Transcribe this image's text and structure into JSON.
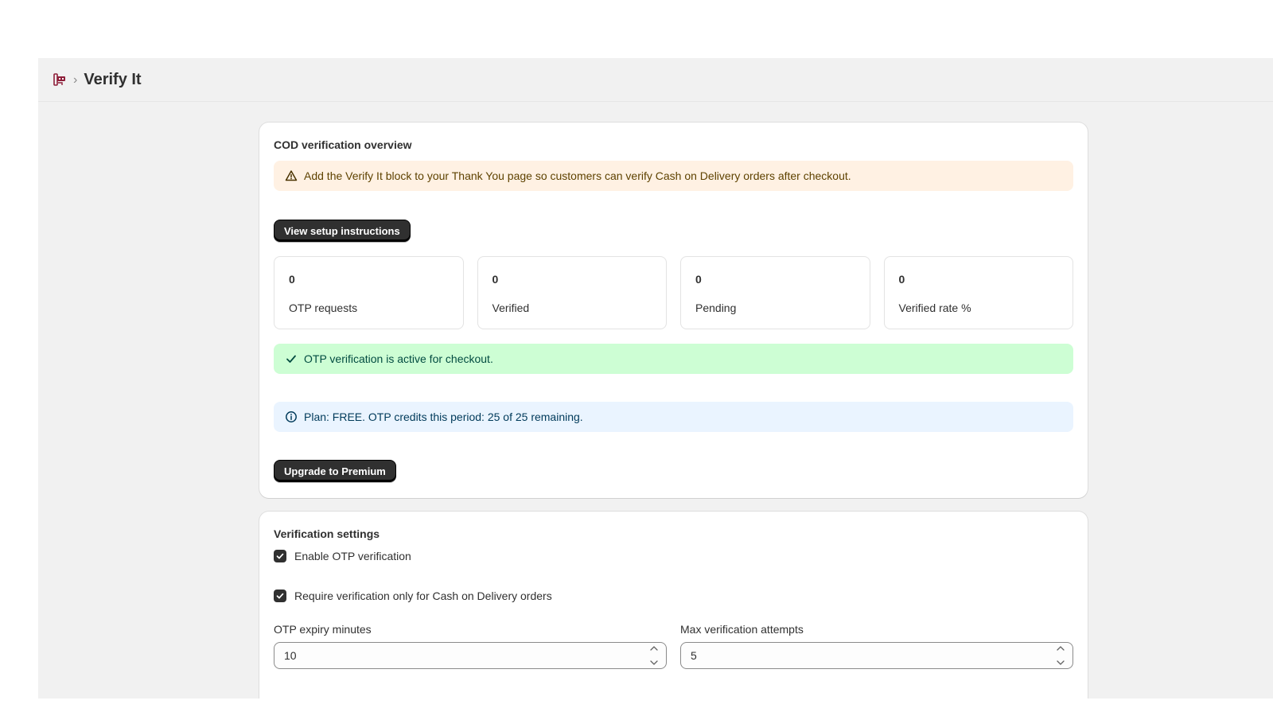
{
  "app": {
    "title": "Verify It",
    "breadcrumb_separator": "›",
    "icon": "app-logo-icon",
    "accent_color": "#8e1f3a"
  },
  "overview": {
    "title": "COD verification overview",
    "warning_banner": {
      "icon": "warning-triangle-icon",
      "text": "Add the Verify It block to your Thank You page so customers can verify Cash on Delivery orders after checkout."
    },
    "setup_button_label": "View setup instructions",
    "stats": [
      {
        "value": "0",
        "label": "OTP requests"
      },
      {
        "value": "0",
        "label": "Verified"
      },
      {
        "value": "0",
        "label": "Pending"
      },
      {
        "value": "0",
        "label": "Verified rate %"
      }
    ],
    "success_banner": {
      "icon": "checkmark-icon",
      "text": "OTP verification is active for checkout."
    },
    "info_banner": {
      "icon": "info-icon",
      "text": "Plan: FREE. OTP credits this period: 25 of 25 remaining."
    },
    "upgrade_button_label": "Upgrade to Premium"
  },
  "settings": {
    "title": "Verification settings",
    "checkboxes": [
      {
        "label": "Enable OTP verification",
        "checked": true
      },
      {
        "label": "Require verification only for Cash on Delivery orders",
        "checked": true
      }
    ],
    "otp_expiry": {
      "label": "OTP expiry minutes",
      "value": "10"
    },
    "max_attempts": {
      "label": "Max verification attempts",
      "value": "5"
    }
  },
  "colors": {
    "warning_bg": "#fff1e3",
    "success_bg": "#cdfed4",
    "info_bg": "#eaf4ff",
    "primary_button": "#303030"
  }
}
